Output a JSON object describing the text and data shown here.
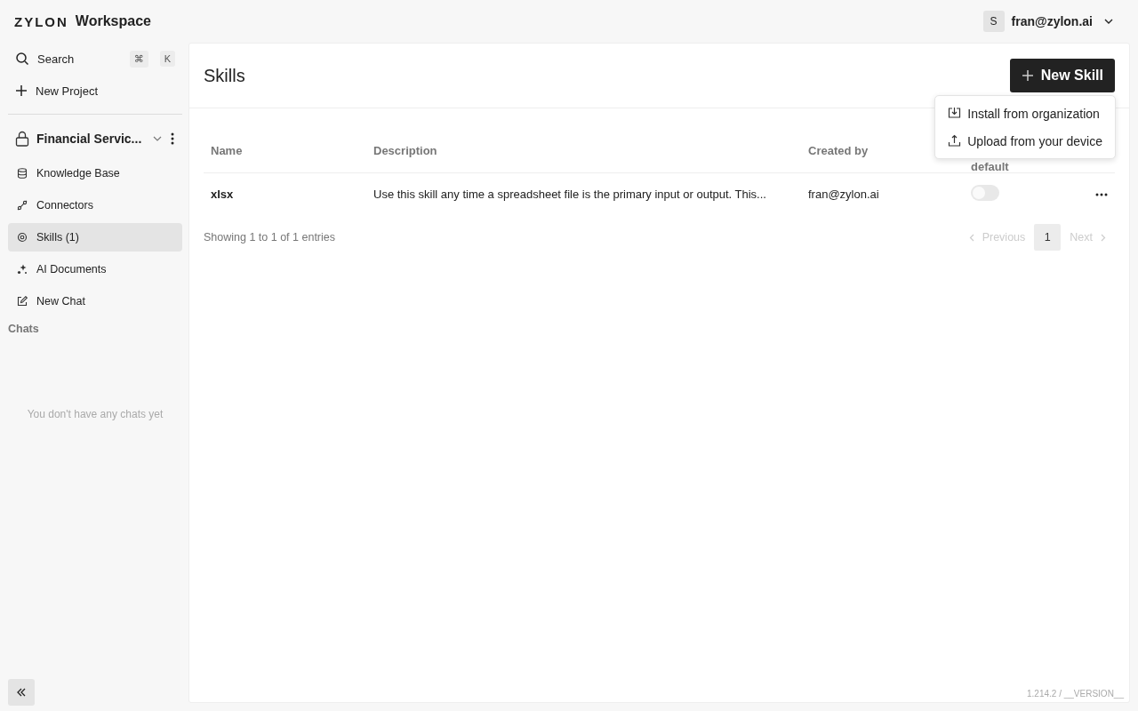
{
  "brand": {
    "logo": "ZYLON",
    "name": "Workspace"
  },
  "user": {
    "initial": "S",
    "email": "fran@zylon.ai"
  },
  "sidebar": {
    "search": {
      "label": "Search",
      "keys": [
        "⌘",
        "K"
      ]
    },
    "new_project": "New Project",
    "project": {
      "name": "Financial Servic...",
      "expanded": true
    },
    "items": [
      {
        "label": "Knowledge Base",
        "kind": "database",
        "selected": false
      },
      {
        "label": "Connectors",
        "kind": "plug",
        "selected": false
      },
      {
        "label": "Skills (1)",
        "kind": "gear",
        "selected": true
      },
      {
        "label": "AI Documents",
        "kind": "sparkles",
        "selected": false
      },
      {
        "label": "New Chat",
        "kind": "edit",
        "selected": false
      }
    ],
    "chats_heading": "Chats",
    "chats_empty": "You don't have any chats yet"
  },
  "page": {
    "title": "Skills",
    "new_button": "New Skill"
  },
  "menu": [
    {
      "label": "Install from organization",
      "kind": "download"
    },
    {
      "label": "Upload from your device",
      "kind": "upload"
    }
  ],
  "table": {
    "columns": [
      "Name",
      "Description",
      "Created by",
      "default"
    ],
    "rows": [
      {
        "name": "xlsx",
        "description": "Use this skill any time a spreadsheet file is the primary input or output. This...",
        "created_by": "fran@zylon.ai",
        "on": false
      }
    ]
  },
  "pagination": {
    "summary": "Showing 1 to 1 of 1 entries",
    "previous": "Previous",
    "pages": [
      {
        "label": "1",
        "selected": true
      }
    ],
    "next": "Next"
  },
  "version": "1.214.2 / __VERSION__"
}
